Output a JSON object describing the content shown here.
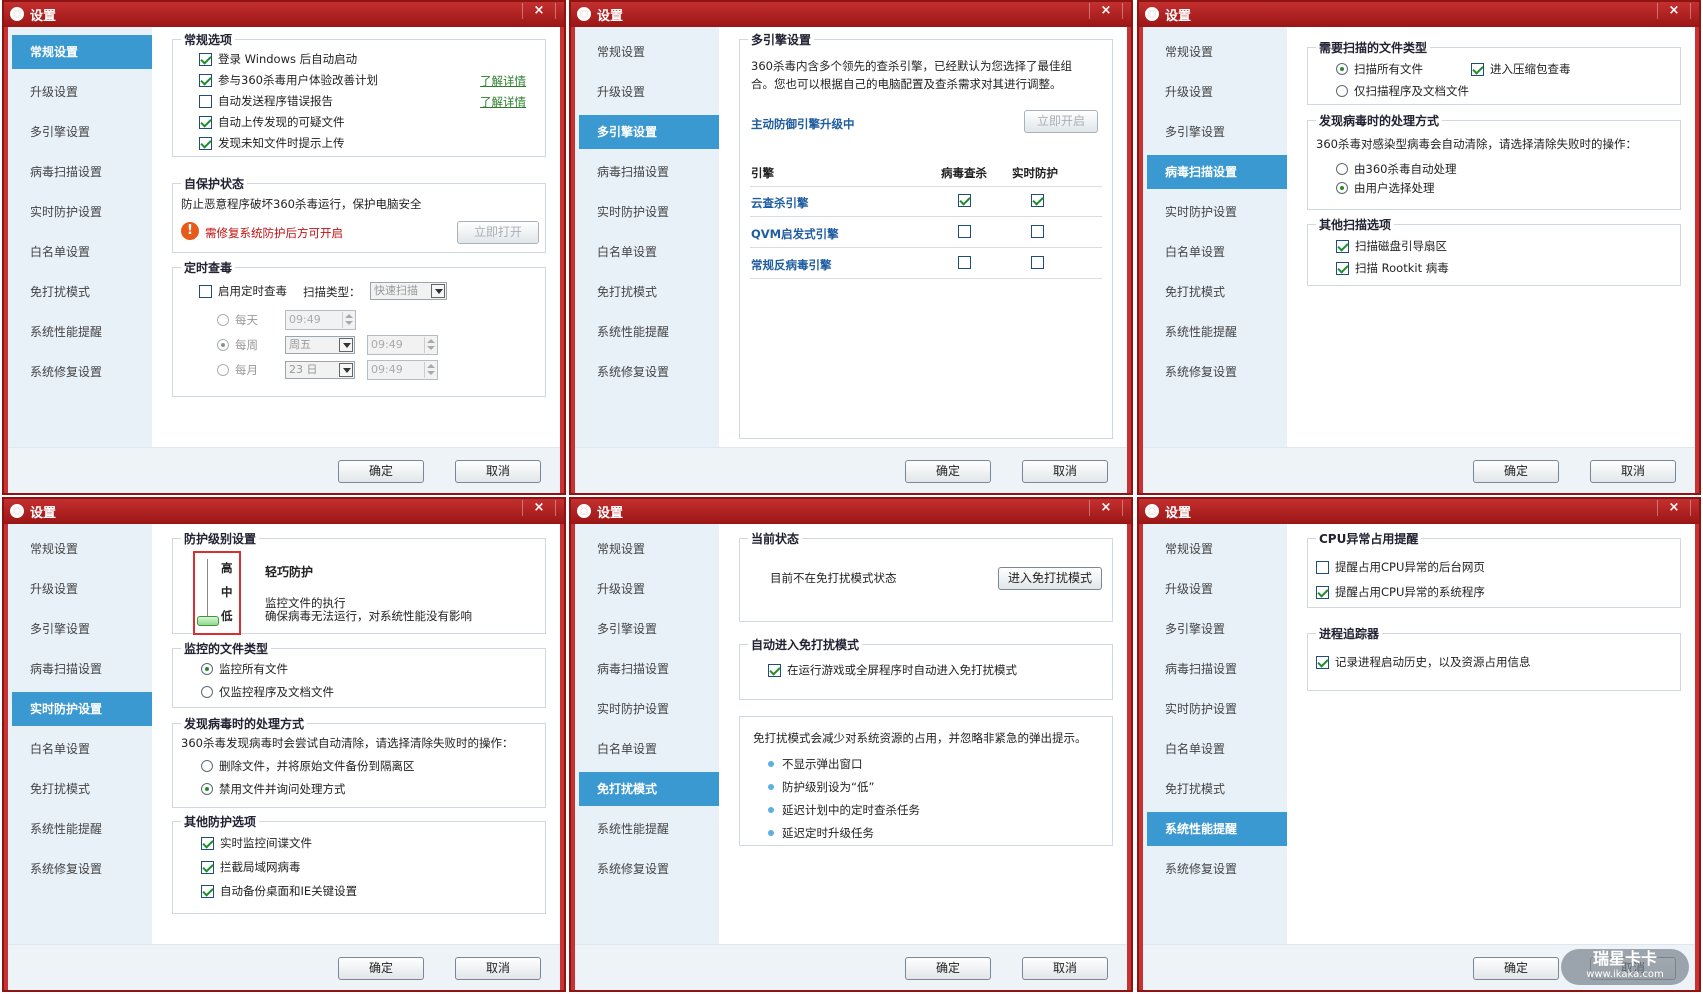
{
  "title": "设置",
  "close": "×",
  "nav": [
    "常规设置",
    "升级设置",
    "多引擎设置",
    "病毒扫描设置",
    "实时防护设置",
    "白名单设置",
    "免打扰模式",
    "系统性能提醒",
    "系统修复设置"
  ],
  "buttons": {
    "ok": "确定",
    "cancel": "取消"
  },
  "p1": {
    "g1": "常规选项",
    "c1": "登录 Windows 后自动启动",
    "c2": "参与360杀毒用户体验改善计划",
    "c3": "自动发送程序错误报告",
    "c4": "自动上传发现的可疑文件",
    "c5": "发现未知文件时提示上传",
    "more": "了解详情",
    "g2": "自保护状态",
    "desc": "防止恶意程序破坏360杀毒运行，保护电脑安全",
    "warn_text": "需修复系统防护后方可开启",
    "warn_icon": "!",
    "open": "立即打开",
    "g3": "定时查毒",
    "sched": "启用定时查毒",
    "scan_type": "扫描类型：",
    "scan_type_val": "快速扫描",
    "daily": "每天",
    "weekly": "每周",
    "monthly": "每月",
    "time": "09:49",
    "weekday": "周五",
    "monthday": "23 日"
  },
  "p2": {
    "g1": "多引擎设置",
    "desc1": "360杀毒内含多个领先的查杀引擎，已经默认为您选择了最佳组",
    "desc2": "合。您也可以根据自己的电脑配置及查杀需求对其进行调整。",
    "upgrading": "主动防御引擎升级中",
    "open": "立即开启",
    "h_engine": "引擎",
    "h_scan": "病毒查杀",
    "h_rt": "实时防护",
    "e1": "云查杀引擎",
    "e2": "QVM启发式引擎",
    "e3": "常规反病毒引擎"
  },
  "p3": {
    "g1": "需要扫描的文件类型",
    "r1": "扫描所有文件",
    "c_zip": "进入压缩包查毒",
    "r2": "仅扫描程序及文档文件",
    "g2": "发现病毒时的处理方式",
    "desc": "360杀毒对感染型病毒会自动清除，请选择清除失败时的操作：",
    "r3": "由360杀毒自动处理",
    "r4": "由用户选择处理",
    "g3": "其他扫描选项",
    "c1": "扫描磁盘引导扇区",
    "c2": "扫描 Rootkit 病毒"
  },
  "p4": {
    "g1": "防护级别设置",
    "high": "高",
    "mid": "中",
    "low": "低",
    "level": "轻巧防护",
    "d1": "监控文件的执行",
    "d2": "确保病毒无法运行，对系统性能没有影响",
    "g2": "监控的文件类型",
    "r1": "监控所有文件",
    "r2": "仅监控程序及文档文件",
    "g3": "发现病毒时的处理方式",
    "desc": "360杀毒发现病毒时会尝试自动清除，请选择清除失败时的操作：",
    "r3": "删除文件，并将原始文件备份到隔离区",
    "r4": "禁用文件并询问处理方式",
    "g4": "其他防护选项",
    "c1": "实时监控间谍文件",
    "c2": "拦截局域网病毒",
    "c3": "自动备份桌面和IE关键设置"
  },
  "p5": {
    "g1": "当前状态",
    "status": "目前不在免打扰模式状态",
    "enter": "进入免打扰模式",
    "g2": "自动进入免打扰模式",
    "c1": "在运行游戏或全屏程序时自动进入免打扰模式",
    "desc": "免打扰模式会减少对系统资源的占用，并忽略非紧急的弹出提示。",
    "b1": "不显示弹出窗口",
    "b2": "防护级别设为“低”",
    "b3": "延迟计划中的定时查杀任务",
    "b4": "延迟定时升级任务"
  },
  "p6": {
    "g1": "CPU异常占用提醒",
    "c1": "提醒占用CPU异常的后台网页",
    "c2": "提醒占用CPU异常的系统程序",
    "g2": "进程追踪器",
    "c3": "记录进程启动历史，以及资源占用信息"
  },
  "watermark": {
    "main": "瑞星卡卡",
    "sub": "www.ikaka.com"
  }
}
